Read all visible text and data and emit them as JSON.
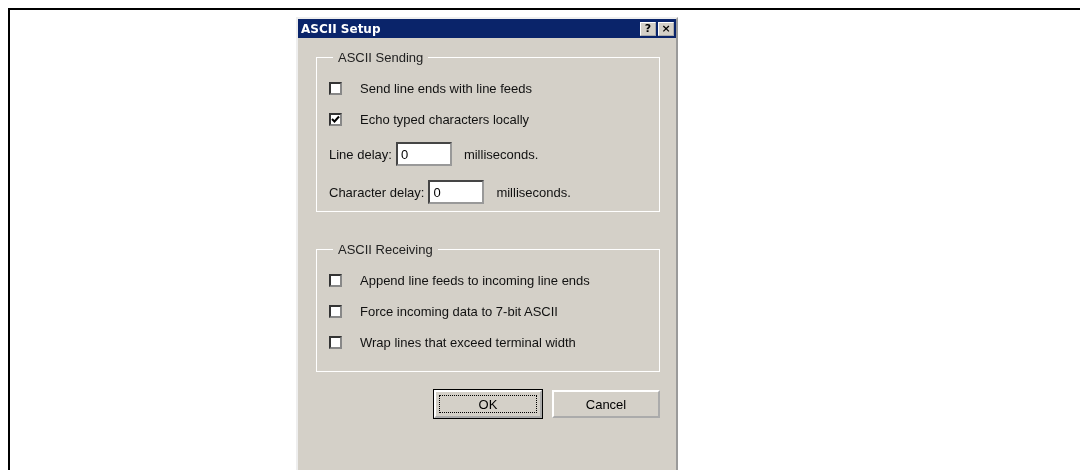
{
  "window": {
    "title": "ASCII Setup",
    "title_buttons": [
      "?",
      "×"
    ]
  },
  "groups": [
    {
      "title": "ASCII Sending",
      "items": [
        {
          "kind": "checkbox",
          "label": "Send line ends with line feeds",
          "checked": false
        },
        {
          "kind": "checkbox",
          "label": "Echo typed characters locally",
          "checked": true
        },
        {
          "kind": "number",
          "label": "Line delay:",
          "value": "0",
          "unit": "milliseconds."
        },
        {
          "kind": "number",
          "label": "Character delay:",
          "value": "0",
          "unit": "milliseconds."
        }
      ]
    },
    {
      "title": "ASCII Receiving",
      "items": [
        {
          "kind": "checkbox",
          "label": "Append line feeds to incoming line ends",
          "checked": false
        },
        {
          "kind": "checkbox",
          "label": "Force incoming data to 7-bit ASCII",
          "checked": false
        },
        {
          "kind": "checkbox",
          "label": "Wrap lines that exceed terminal width",
          "checked": false
        }
      ]
    }
  ],
  "buttons": [
    {
      "label": "OK",
      "focused": true
    },
    {
      "label": "Cancel",
      "focused": false
    }
  ]
}
